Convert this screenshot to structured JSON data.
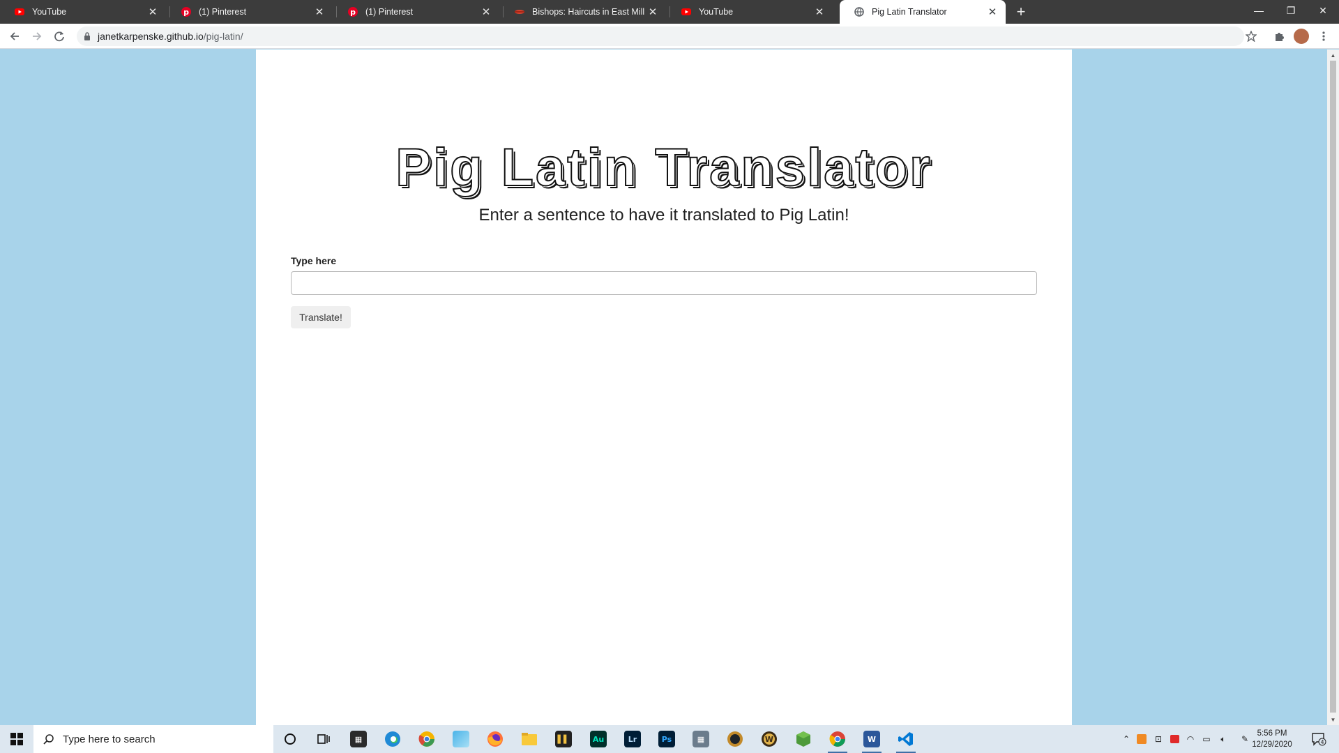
{
  "browser": {
    "tabs": [
      {
        "title": "YouTube",
        "icon": "youtube-icon",
        "active": false
      },
      {
        "title": "(1) Pinterest",
        "icon": "pinterest-icon",
        "active": false
      },
      {
        "title": "(1) Pinterest",
        "icon": "pinterest-icon",
        "active": false
      },
      {
        "title": "Bishops: Haircuts in East Mill Plain",
        "icon": "bishops-icon",
        "active": false
      },
      {
        "title": "YouTube",
        "icon": "youtube-icon",
        "active": false
      },
      {
        "title": "Pig Latin Translator",
        "icon": "globe-icon",
        "active": true
      }
    ],
    "url_host": "janetkarpenske.github.io",
    "url_path": "/pig-latin/"
  },
  "page": {
    "title": "Pig Latin Translator",
    "subtitle": "Enter a sentence to have it translated to Pig Latin!",
    "input_label": "Type here",
    "input_value": "",
    "button_label": "Translate!",
    "background_color": "#a8d3ea",
    "panel_color": "#ffffff"
  },
  "taskbar": {
    "search_placeholder": "Type here to search",
    "apps": [
      "cortana-icon",
      "task-view-icon",
      "store-icon",
      "edge-icon",
      "chrome-canary-icon",
      "maps-icon",
      "firefox-icon",
      "file-explorer-icon",
      "books-icon",
      "audition-icon",
      "lightroom-icon",
      "photoshop-icon",
      "calculator-icon",
      "league-icon",
      "wow-icon",
      "minecraft-icon",
      "chrome-icon",
      "word-icon",
      "vscode-icon"
    ],
    "app_labels": {
      "audition": "Au",
      "lightroom": "Lr",
      "photoshop": "Ps",
      "word": "W"
    },
    "time": "5:56 PM",
    "date": "12/29/2020",
    "notification_count": "4"
  }
}
